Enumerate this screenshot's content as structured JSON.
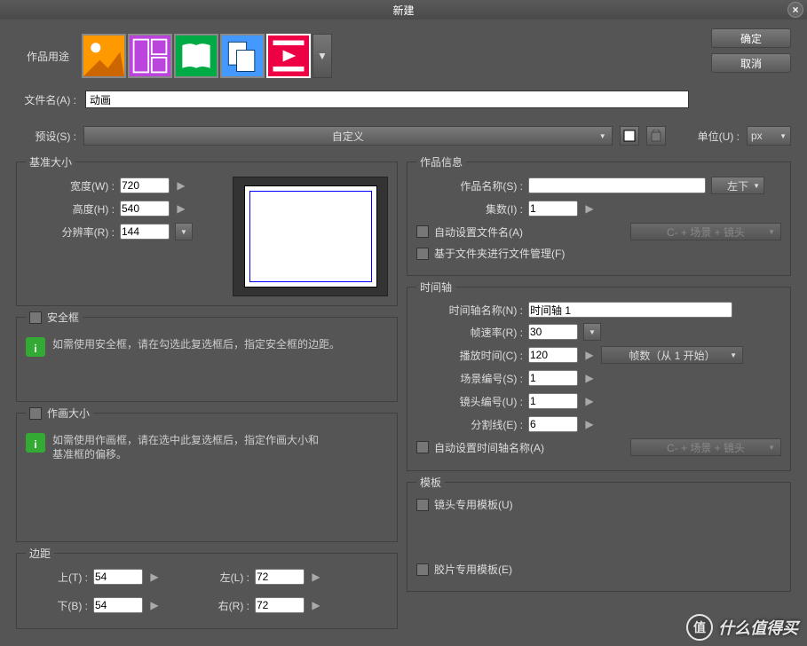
{
  "title": "新建",
  "buttons": {
    "ok": "确定",
    "cancel": "取消"
  },
  "purpose_label": "作品用途",
  "filename": {
    "label": "文件名(A) :",
    "value": "动画"
  },
  "preset": {
    "label": "预设(S) :",
    "value": "自定义"
  },
  "unit": {
    "label": "单位(U) :",
    "value": "px"
  },
  "base_size": {
    "title": "基准大小",
    "width": {
      "label": "宽度(W) :",
      "value": "720"
    },
    "height": {
      "label": "高度(H) :",
      "value": "540"
    },
    "res": {
      "label": "分辨率(R) :",
      "value": "144"
    }
  },
  "safe_frame": {
    "label": "安全框",
    "info": "如需使用安全框，请在勾选此复选框后，指定安全框的边距。"
  },
  "draw_size": {
    "label": "作画大小",
    "info": "如需使用作画框，请在选中此复选框后，指定作画大小和基准框的偏移。"
  },
  "margins": {
    "title": "边距",
    "top": {
      "label": "上(T) :",
      "value": "54"
    },
    "bottom": {
      "label": "下(B) :",
      "value": "54"
    },
    "left": {
      "label": "左(L) :",
      "value": "72"
    },
    "right": {
      "label": "右(R) :",
      "value": "72"
    }
  },
  "work_info": {
    "title": "作品信息",
    "name": {
      "label": "作品名称(S) :",
      "value": ""
    },
    "position": "左下",
    "episode": {
      "label": "集数(I) :",
      "value": "1"
    },
    "auto_file": "自动设置文件名(A)",
    "folder_mgmt": "基于文件夹进行文件管理(F)",
    "pattern": "C- + 场景 + 镜头"
  },
  "timeline": {
    "title": "时间轴",
    "name": {
      "label": "时间轴名称(N) :",
      "value": "时间轴 1"
    },
    "fps": {
      "label": "帧速率(R) :",
      "value": "30"
    },
    "playtime": {
      "label": "播放时间(C) :",
      "value": "120"
    },
    "frame_unit": "帧数（从 1 开始）",
    "scene": {
      "label": "场景编号(S) :",
      "value": "1"
    },
    "cut": {
      "label": "镜头编号(U) :",
      "value": "1"
    },
    "divider": {
      "label": "分割线(E) :",
      "value": "6"
    },
    "auto_name": "自动设置时间轴名称(A)",
    "pattern": "C- + 场景 + 镜头"
  },
  "template": {
    "title": "模板",
    "cut_template": "镜头专用模板(U)",
    "cel_template": "胶片专用模板(E)"
  },
  "watermark": "什么值得买"
}
